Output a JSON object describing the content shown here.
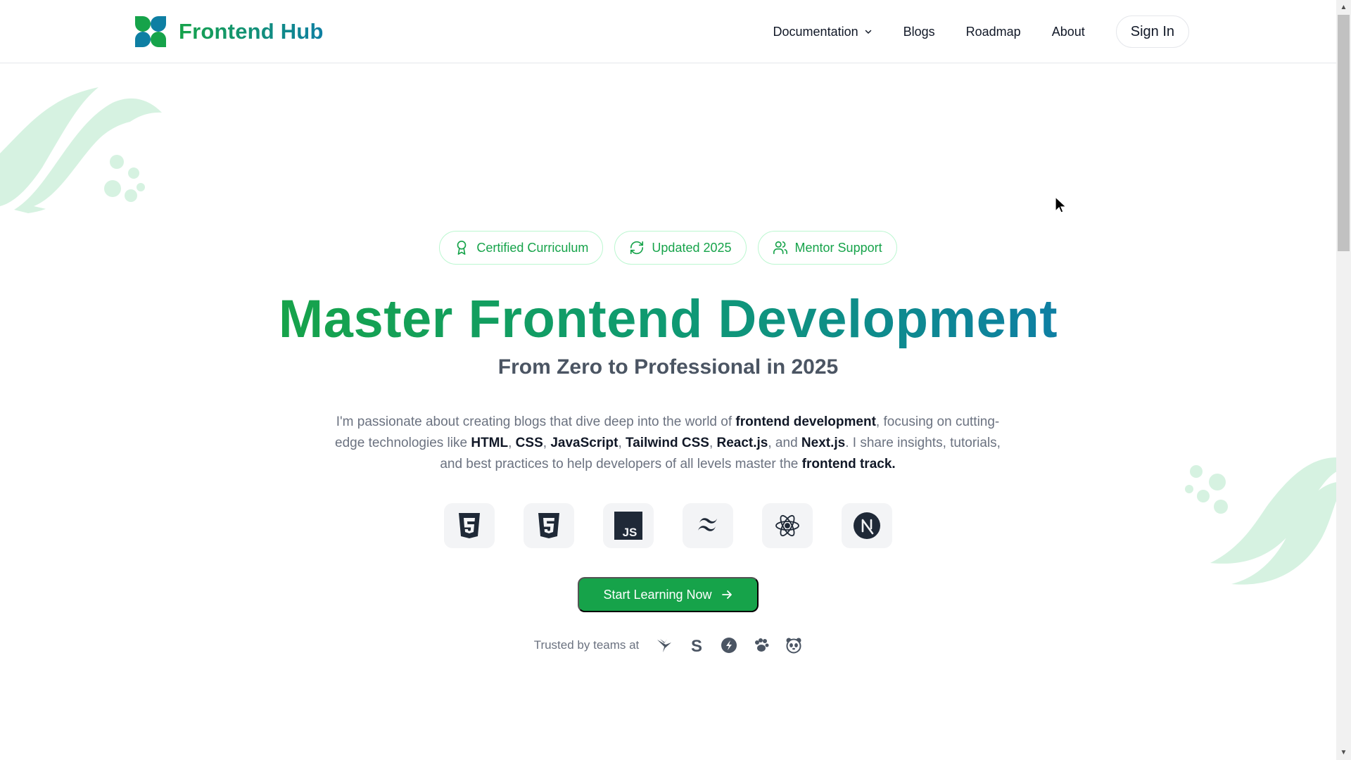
{
  "brand": {
    "name": "Frontend Hub",
    "gradient_start": "#16a34a",
    "gradient_end": "#0e7fa3"
  },
  "nav": {
    "items": [
      {
        "label": "Documentation",
        "has_dropdown": true
      },
      {
        "label": "Blogs"
      },
      {
        "label": "Roadmap"
      },
      {
        "label": "About"
      }
    ],
    "sign_in": "Sign In"
  },
  "badges": [
    {
      "label": "Certified Curriculum",
      "icon": "award-icon"
    },
    {
      "label": "Updated 2025",
      "icon": "refresh-icon"
    },
    {
      "label": "Mentor Support",
      "icon": "users-icon"
    }
  ],
  "hero": {
    "title": "Master Frontend Development",
    "subtitle": "From Zero to Professional in 2025",
    "desc": {
      "p1": "I'm passionate about creating blogs that dive deep into the world of ",
      "b1": "frontend development",
      "p2": ", focusing on cutting-edge technologies like ",
      "b2": "HTML",
      "s1": ", ",
      "b3": "CSS",
      "s2": ", ",
      "b4": "JavaScript",
      "s3": ", ",
      "b5": "Tailwind CSS",
      "s4": ", ",
      "b6": "React.js",
      "s5": ", and ",
      "b7": "Next.js",
      "p3": ". I share insights, tutorials, and best practices to help developers of all levels master the ",
      "b8": "frontend track."
    }
  },
  "tech_icons": [
    "html5-icon",
    "css3-icon",
    "javascript-icon",
    "tailwind-icon",
    "react-icon",
    "nextjs-icon"
  ],
  "cta": {
    "label": "Start Learning Now"
  },
  "trusted": {
    "label": "Trusted by teams at",
    "logos": [
      "bird-logo-icon",
      "s-logo-icon",
      "bolt-logo-icon",
      "paw-logo-icon",
      "panda-logo-icon"
    ]
  },
  "colors": {
    "accent": "#16a34a",
    "badge_border": "#bbf7d0",
    "muted": "#6b7280",
    "decoration": "#d1f2df"
  }
}
